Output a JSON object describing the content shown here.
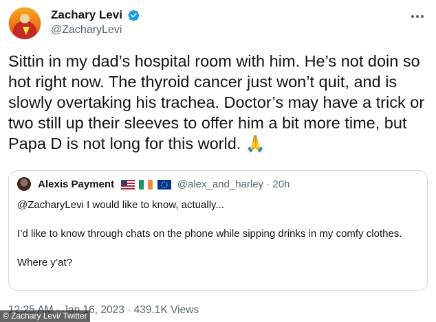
{
  "tweet": {
    "author": {
      "display_name": "Zachary Levi",
      "handle": "@ZacharyLevi",
      "verified": true,
      "avatar_icon": "avatar"
    },
    "text": "Sittin in my dad’s hospital room with him. He’s not doin so hot right now. The thyroid cancer just won’t quit, and is slowly overtaking his trachea. Doctor’s may have a trick or two still up their sleeves to offer him a bit more time, but Papa D is not long for this world. 🙏",
    "meta": "12:25 AM · Jan 16, 2023 · 439.1K Views",
    "more_icon": "more-icon"
  },
  "quote": {
    "display_name": "Alexis Payment",
    "flags": [
      "US",
      "IE",
      "EU"
    ],
    "handle_time": "@alex_and_harley · 20h",
    "paragraphs": [
      "@ZacharyLevi I would like to know, actually...",
      "I’d like to know through chats on the phone while sipping drinks in my comfy clothes.",
      "Where y’at?"
    ]
  },
  "credit": "© Zachary Levi/ Twitter",
  "colors": {
    "text": "#0f1419",
    "secondary": "#536471",
    "verified": "#1d9bf0",
    "border": "#cfd9de"
  }
}
